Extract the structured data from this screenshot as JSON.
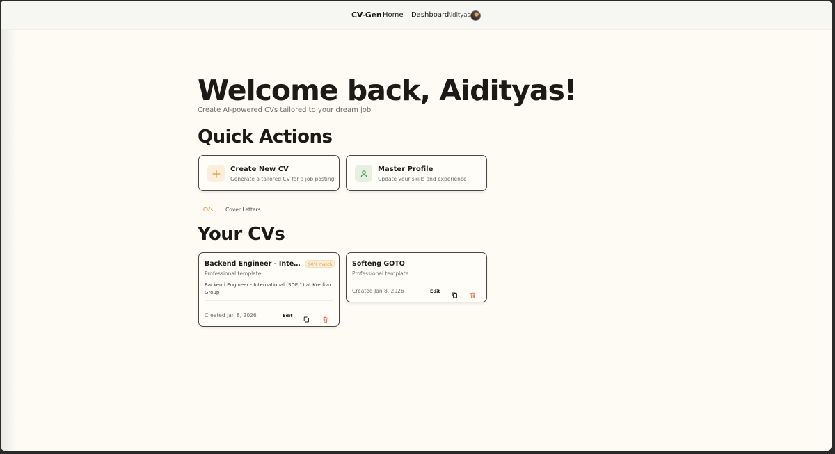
{
  "nav": {
    "brand": "CV-Gen",
    "links": [
      "Home",
      "Dashboard"
    ],
    "user_name": "Aidityas"
  },
  "hero": {
    "title": "Welcome back, Aidityas!",
    "subtitle": "Create AI-powered CVs tailored to your dream job"
  },
  "quick_actions": {
    "title": "Quick Actions",
    "items": [
      {
        "label": "Create New CV",
        "description": "Generate a tailored CV for a job posting",
        "icon": "plus-icon",
        "accent": "#e29b3a"
      },
      {
        "label": "Master Profile",
        "description": "Update your skills and experience",
        "icon": "user-icon",
        "accent": "#3f8f4a"
      }
    ]
  },
  "tabs": {
    "items": [
      "CVs",
      "Cover Letters"
    ],
    "active": "CVs"
  },
  "cvs": {
    "title": "Your CVs",
    "items": [
      {
        "title": "Backend Engineer - Internatio...",
        "match": "90% match",
        "template": "Professional template",
        "description": "Backend Engineer - International (SDE 1) at Kredivo Group",
        "created": "Created Jan 8, 2026",
        "edit_label": "Edit"
      },
      {
        "title": "Softeng GOTO",
        "template": "Professional template",
        "created": "Created Jan 8, 2026",
        "edit_label": "Edit"
      }
    ]
  },
  "colors": {
    "accent": "#d59130",
    "delete": "#e0664f",
    "background": "#fdfbf4"
  }
}
